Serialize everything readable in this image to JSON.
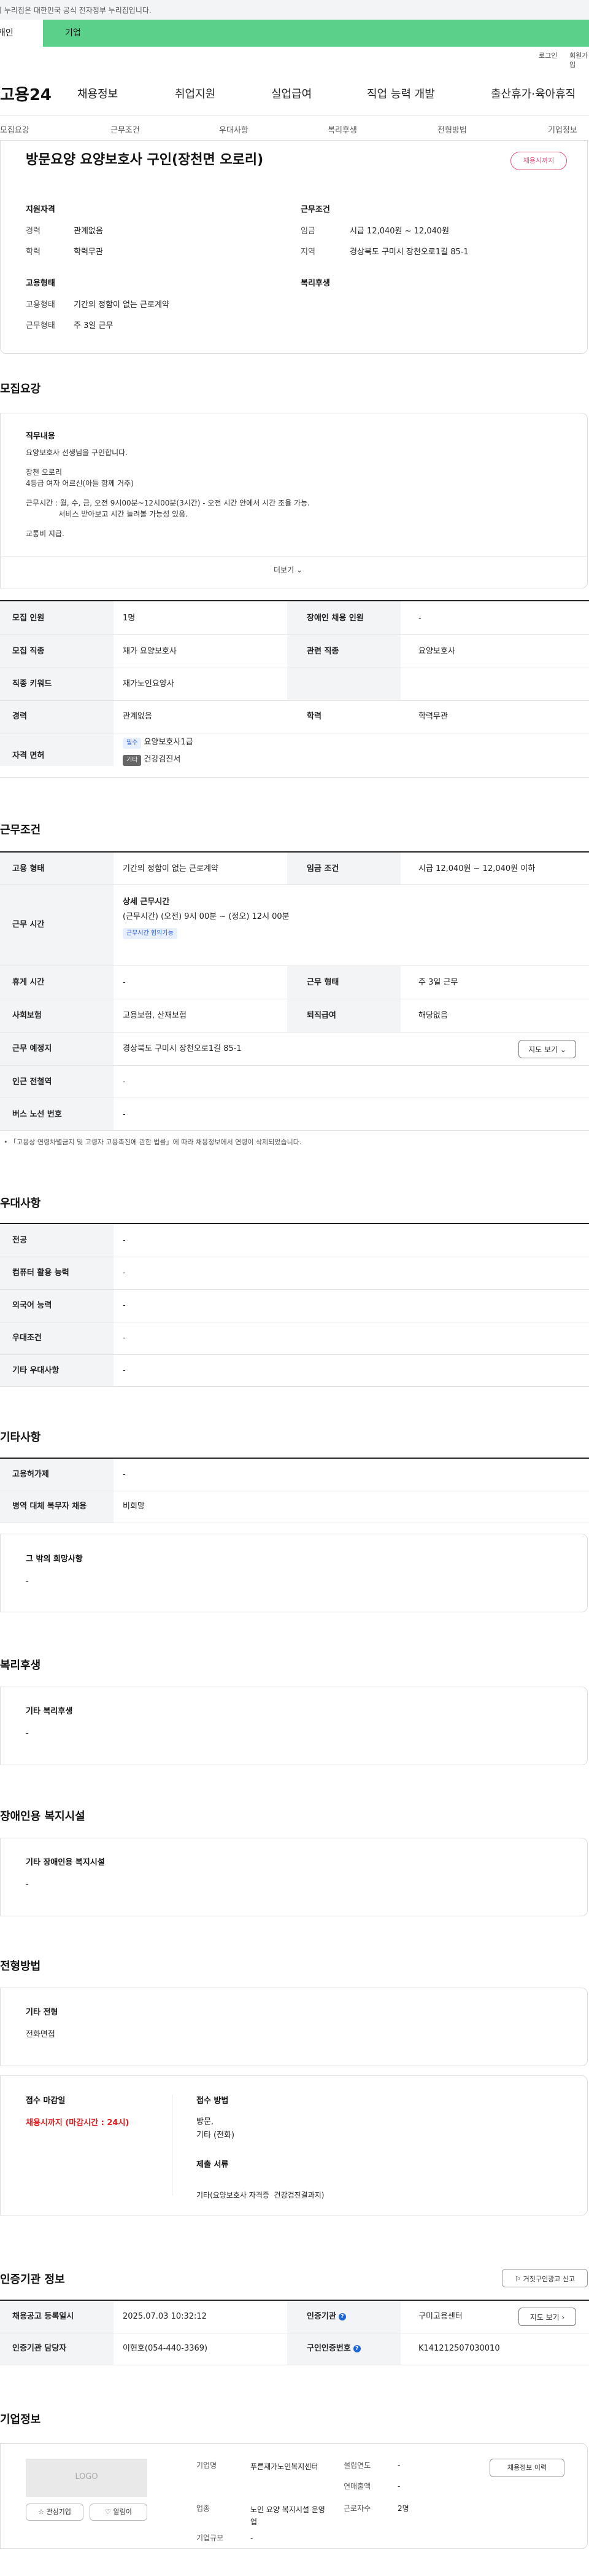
{
  "gov_banner": "이 누리집은 대한민국 공식 전자정부 누리집입니다.",
  "tabs": [
    "개인",
    "기업"
  ],
  "utility": [
    "로그인",
    "회원가입"
  ],
  "logo": "고용24",
  "gnav": [
    "채용정보",
    "취업지원",
    "실업급여",
    "직업 능력 개발",
    "출산휴가·육아휴직"
  ],
  "lnb": [
    "모집요강",
    "근무조건",
    "우대사항",
    "복리후생",
    "전형방법",
    "기업정보"
  ],
  "job": {
    "title": "방문요양 요양보호사 구인(장천면 오로리)",
    "badge": "채용시까지",
    "qual_label": "지원자격",
    "career_k": "경력",
    "career_v": "관계없음",
    "edu_k": "학력",
    "edu_v": "학력무관",
    "cond_label": "근무조건",
    "wage_k": "임금",
    "wage_v": "시급 12,040원 ~ 12,040원",
    "loc_k": "지역",
    "loc_v": "경상북도 구미시 장천오로1길 85-1",
    "emp_label": "고용형태",
    "etype_k": "고용형태",
    "etype_v": "기간의 정함이 없는 근로계약",
    "wtype_k": "근무형태",
    "wtype_v": "주 3일 근무",
    "welfare_label": "복리후생"
  },
  "recruit": {
    "heading": "모집요강",
    "duty_label": "직무내용",
    "duty_lines": [
      "요양보호사 선생님을 구인합니다.",
      "",
      "장천 오로리",
      "4등급 여자 어르신(아들 함께 거주)",
      "",
      "근무시간 : 월, 수, 금, 오전 9시00분~12시00분(3시간) - 오전 시간 안에서 시간 조율 가능.",
      "              서비스 받아보고 시간 늘려볼 가능성 있음.",
      "",
      "교통비 지급."
    ],
    "more": "더보기",
    "rows": [
      {
        "k1": "모집 인원",
        "v1": "1명",
        "k2": "장애인 채용 인원",
        "v2": "-"
      },
      {
        "k1": "모집 직종",
        "v1": "재가 요양보호사",
        "k2": "관련 직종",
        "v2": "요양보호사"
      },
      {
        "k1": "직종 키워드",
        "v1": "재가노인요양사",
        "k2": "",
        "v2": ""
      },
      {
        "k1": "경력",
        "v1": "관계없음",
        "k2": "학력",
        "v2": "학력무관"
      }
    ],
    "license_k": "자격 면허",
    "license_tag1": "필수",
    "license_v1": "요양보호사1급",
    "license_tag2": "기타",
    "license_v2": "건강검진서"
  },
  "conditions": {
    "heading": "근무조건",
    "emp_k": "고용 형태",
    "emp_v": "기간의 정함이 없는 근로계약",
    "wage_k": "임금 조건",
    "wage_v": "시급 12,040원 ~ 12,040원 이하",
    "hours_k": "근무 시간",
    "hours_title": "상세 근무시간",
    "hours_v": "(근무시간) (오전) 9시 00분 ~ (정오) 12시 00분",
    "hours_tag": "근무시간 협의가능",
    "break_k": "휴게 시간",
    "break_v": "-",
    "wform_k": "근무 형태",
    "wform_v": "주 3일 근무",
    "ins_k": "사회보험",
    "ins_v": "고용보험, 산재보험",
    "sev_k": "퇴직급여",
    "sev_v": "해당없음",
    "place_k": "근무 예정지",
    "place_v": "경상북도 구미시 장천오로1길 85-1",
    "map_btn": "지도 보기",
    "subway_k": "인근 전철역",
    "subway_v": "-",
    "bus_k": "버스 노선 번호",
    "bus_v": "-",
    "note": "「고용상 연령차별금지 및 고령자 고용촉진에 관한 법률」에 따라 채용정보에서 연령이 삭제되었습니다."
  },
  "preference": {
    "heading": "우대사항",
    "rows": [
      {
        "k": "전공",
        "v": "-"
      },
      {
        "k": "컴퓨터 활용 능력",
        "v": "-"
      },
      {
        "k": "외국어 능력",
        "v": "-"
      },
      {
        "k": "우대조건",
        "v": "-"
      },
      {
        "k": "기타 우대사항",
        "v": "-"
      }
    ]
  },
  "etc": {
    "heading": "기타사항",
    "rows": [
      {
        "k": "고용허가제",
        "v": "-"
      },
      {
        "k": "병역 대체 복무자 채용",
        "v": "비희망"
      }
    ],
    "other_label": "그 밖의 희망사항",
    "other_v": "-"
  },
  "welfare": {
    "heading": "복리후생",
    "label": "기타 복리후생",
    "v": "-"
  },
  "disabled": {
    "heading": "장애인용 복지시설",
    "label": "기타 장애인용 복지시설",
    "v": "-"
  },
  "process": {
    "heading": "전형방법",
    "label": "기타 전형",
    "v": "전화면접",
    "deadline_label": "접수 마감일",
    "deadline_v": "채용시까지 (마감시간 : 24시)",
    "method_label": "접수 방법",
    "method_v1": "방문,",
    "method_v2": "기타 (전화)",
    "docs_label": "제출 서류",
    "docs_v": "기타(요양보호사 자격증  건강검진결과지)"
  },
  "certify": {
    "heading": "인증기관 정보",
    "report_btn": "거짓구인광고 신고",
    "reg_k": "채용공고 등록일시",
    "reg_v": "2025.07.03 10:32:12",
    "org_k": "인증기관",
    "org_v": "구미고용센터",
    "map_btn": "지도 보기",
    "mgr_k": "인증기관 담당자",
    "mgr_v": "이현호(054-440-3369)",
    "num_k": "구인인증번호",
    "num_v": "K141212507030010"
  },
  "company": {
    "heading": "기업정보",
    "logo": "LOGO",
    "fav_btn": "관심기업",
    "alarm_btn": "알림이",
    "name_k": "기업명",
    "name_v": "푸른재가노인복지센터",
    "year_k": "설립연도",
    "year_v": "-",
    "sales_k": "연매출액",
    "sales_v": "-",
    "ind_k": "업종",
    "ind_v": "노인 요양 복지시설 운영업",
    "emp_k": "근로자수",
    "emp_v": "2명",
    "size_k": "기업규모",
    "size_v": "-",
    "jobs_btn": "채용정보 이력"
  }
}
